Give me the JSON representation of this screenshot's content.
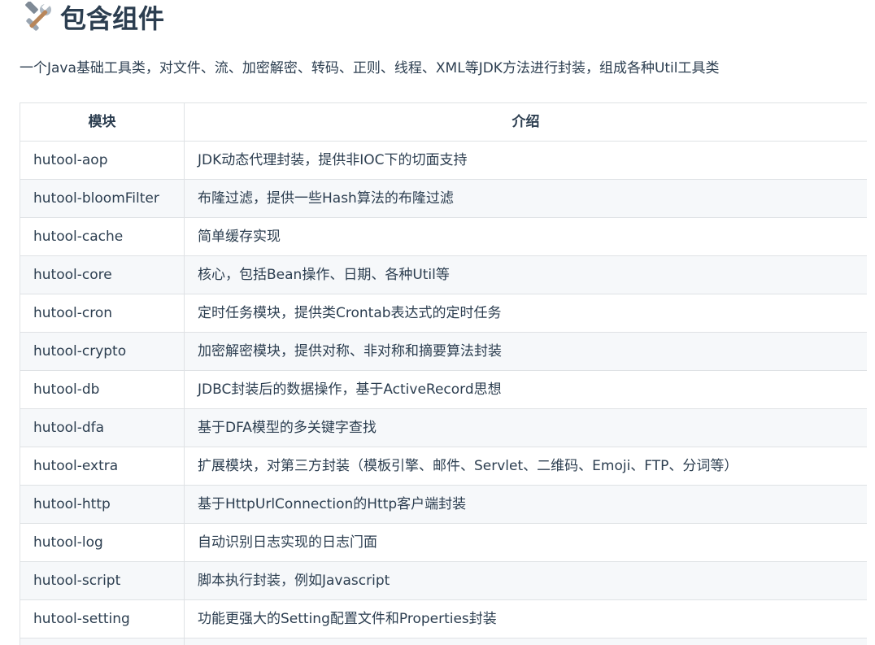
{
  "heading": {
    "icon": "hammer-wrench-icon",
    "text": "包含组件"
  },
  "intro": "一个Java基础工具类，对文件、流、加密解密、转码、正则、线程、XML等JDK方法进行封装，组成各种Util工具类",
  "table": {
    "headers": [
      "模块",
      "介绍"
    ],
    "rows": [
      {
        "module": "hutool-aop",
        "description": "JDK动态代理封装，提供非IOC下的切面支持"
      },
      {
        "module": "hutool-bloomFilter",
        "description": "布隆过滤，提供一些Hash算法的布隆过滤"
      },
      {
        "module": "hutool-cache",
        "description": "简单缓存实现"
      },
      {
        "module": "hutool-core",
        "description": "核心，包括Bean操作、日期、各种Util等"
      },
      {
        "module": "hutool-cron",
        "description": "定时任务模块，提供类Crontab表达式的定时任务"
      },
      {
        "module": "hutool-crypto",
        "description": "加密解密模块，提供对称、非对称和摘要算法封装"
      },
      {
        "module": "hutool-db",
        "description": "JDBC封装后的数据操作，基于ActiveRecord思想"
      },
      {
        "module": "hutool-dfa",
        "description": "基于DFA模型的多关键字查找"
      },
      {
        "module": "hutool-extra",
        "description": "扩展模块，对第三方封装（模板引擎、邮件、Servlet、二维码、Emoji、FTP、分词等）"
      },
      {
        "module": "hutool-http",
        "description": "基于HttpUrlConnection的Http客户端封装"
      },
      {
        "module": "hutool-log",
        "description": "自动识别日志实现的日志门面"
      },
      {
        "module": "hutool-script",
        "description": "脚本执行封装，例如Javascript"
      },
      {
        "module": "hutool-setting",
        "description": "功能更强大的Setting配置文件和Properties封装"
      }
    ]
  }
}
